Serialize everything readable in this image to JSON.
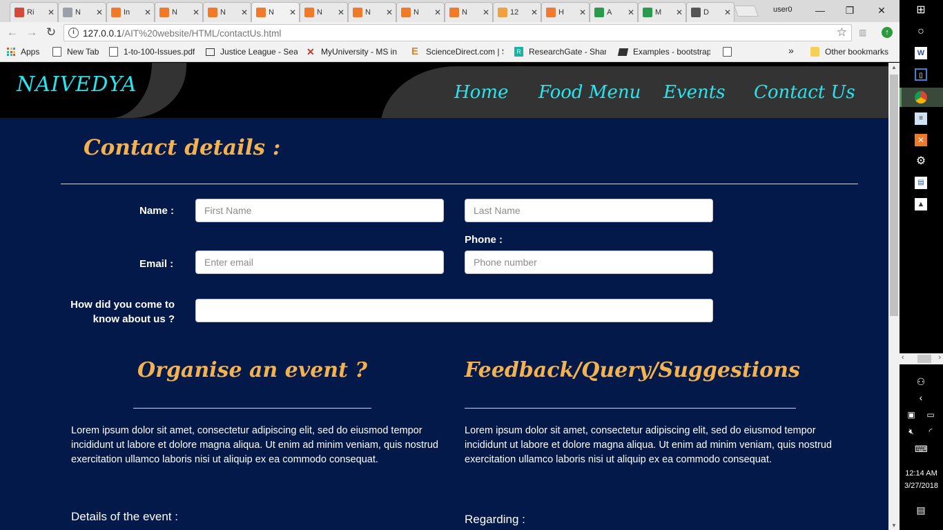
{
  "browser": {
    "tabs": [
      {
        "label": "Ri",
        "color": "#d14a3a"
      },
      {
        "label": "N",
        "color": "#9aa0a6"
      },
      {
        "label": "In",
        "color": "#f07a2a"
      },
      {
        "label": "N",
        "color": "#f07a2a"
      },
      {
        "label": "N",
        "color": "#f07a2a"
      },
      {
        "label": "N",
        "color": "#f07a2a"
      },
      {
        "label": "N",
        "color": "#f07a2a"
      },
      {
        "label": "N",
        "color": "#f07a2a"
      },
      {
        "label": "N",
        "color": "#f07a2a"
      },
      {
        "label": "N",
        "color": "#f07a2a"
      },
      {
        "label": "12",
        "color": "#f0a040"
      },
      {
        "label": "H",
        "color": "#ee7b31"
      },
      {
        "label": "A",
        "color": "#2a9b4d"
      },
      {
        "label": "M",
        "color": "#2a9b4d"
      },
      {
        "label": "D",
        "color": "#555555"
      }
    ],
    "active_tab_index": 5,
    "tab_close_glyph": "✕",
    "user": "user0",
    "window_controls": {
      "minimize": "—",
      "maximize": "❐",
      "close": "✕"
    },
    "url_prefix": "127.0.0.1",
    "url_path": "/AIT%20website/HTML/contactUs.html",
    "bookmarks": [
      {
        "label": "Apps",
        "icon": "apps-grid-icon"
      },
      {
        "label": "New Tab",
        "icon": "page-icon"
      },
      {
        "label": "1-to-100-Issues.pdf",
        "icon": "page-icon"
      },
      {
        "label": "Justice League - Seas",
        "icon": "tv-icon"
      },
      {
        "label": "MyUniversity - MS in",
        "icon": "x-icon"
      },
      {
        "label": "ScienceDirect.com | S",
        "icon": "elsevier-icon"
      },
      {
        "label": "ResearchGate - Share",
        "icon": "researchgate-icon"
      },
      {
        "label": "Examples - bootstrap",
        "icon": "book-icon"
      }
    ],
    "more_bookmarks": "»",
    "other_bookmarks": "Other bookmarks"
  },
  "site": {
    "brand": "NAIVEDYA",
    "nav": [
      "Home",
      "Food Menu",
      "Events",
      "Contact Us"
    ],
    "contact_title": "Contact details :",
    "form": {
      "name_label": "Name :",
      "first_name_placeholder": "First Name",
      "last_name_placeholder": "Last Name",
      "phone_label": "Phone :",
      "email_label": "Email :",
      "email_placeholder": "Enter email",
      "phone_placeholder": "Phone number",
      "source_label_line1": "How did you come to",
      "source_label_line2": "know about us ?",
      "source_value": ""
    },
    "event_section": {
      "title": "Organise an event ?",
      "text": "Lorem ipsum dolor sit amet, consectetur adipiscing elit, sed do eiusmod tempor incididunt ut labore et dolore magna aliqua. Ut enim ad minim veniam, quis nostrud exercitation ullamco laboris nisi ut aliquip ex ea commodo consequat.",
      "details_label": "Details of the event :"
    },
    "feedback_section": {
      "title": "Feedback/Query/Suggestions",
      "text": "Lorem ipsum dolor sit amet, consectetur adipiscing elit, sed do eiusmod tempor incididunt ut labore et dolore magna aliqua. Ut enim ad minim veniam, quis nostrud exercitation ullamco laboris nisi ut aliquip ex ea commodo consequat.",
      "regarding_label": "Regarding :"
    },
    "colors": {
      "header_bg": "#000000",
      "page_bg": "#03194a",
      "brand": "#28e4ef",
      "accent": "#f3b24f"
    }
  },
  "taskbar": {
    "time": "12:14 AM",
    "date": "3/27/2018"
  }
}
